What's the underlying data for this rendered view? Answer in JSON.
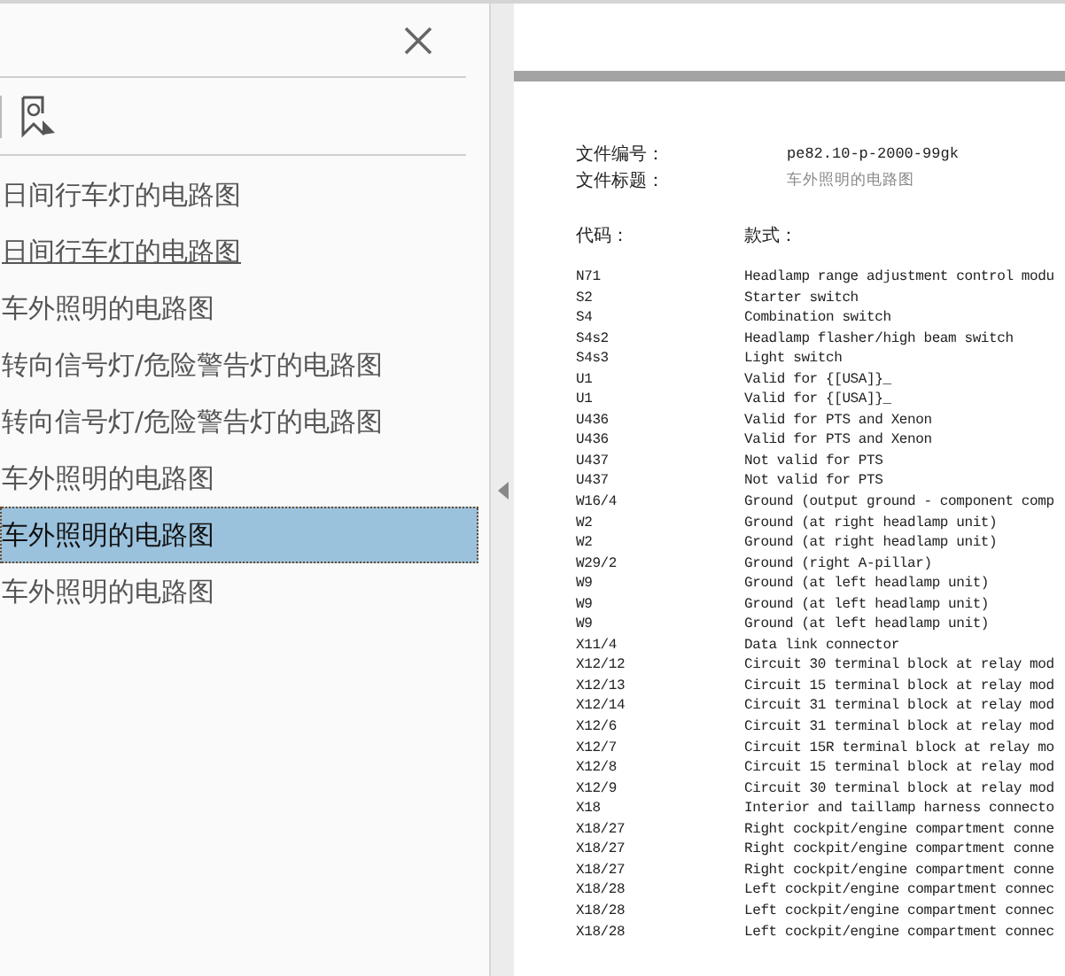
{
  "bookmarks_panel": {
    "items": [
      {
        "label": "日间行车灯的电路图",
        "selected": false,
        "hovered": false
      },
      {
        "label": "日间行车灯的电路图",
        "selected": false,
        "hovered": true
      },
      {
        "label": "车外照明的电路图",
        "selected": false,
        "hovered": false
      },
      {
        "label": "转向信号灯/危险警告灯的电路图",
        "selected": false,
        "hovered": false
      },
      {
        "label": "转向信号灯/危险警告灯的电路图",
        "selected": false,
        "hovered": false
      },
      {
        "label": "车外照明的电路图",
        "selected": false,
        "hovered": false
      },
      {
        "label": "车外照明的电路图",
        "selected": true,
        "hovered": false
      },
      {
        "label": "车外照明的电路图",
        "selected": false,
        "hovered": false
      }
    ]
  },
  "document": {
    "header": [
      {
        "label": "文件编号：",
        "value": "pe82.10-p-2000-99gk"
      },
      {
        "label": "文件标题：",
        "value": "车外照明的电路图"
      }
    ],
    "columns": [
      "代码：",
      "款式："
    ],
    "rows": [
      {
        "code": "N71",
        "description": "Headlamp range adjustment control modu"
      },
      {
        "code": "S2",
        "description": "Starter switch"
      },
      {
        "code": "S4",
        "description": "Combination switch"
      },
      {
        "code": "S4s2",
        "description": "Headlamp flasher/high beam switch"
      },
      {
        "code": "S4s3",
        "description": "Light switch"
      },
      {
        "code": "U1",
        "description": "Valid for {[USA]}_"
      },
      {
        "code": "U1",
        "description": "Valid for {[USA]}_"
      },
      {
        "code": "U436",
        "description": "Valid for PTS and Xenon"
      },
      {
        "code": "U436",
        "description": "Valid for PTS and Xenon"
      },
      {
        "code": "U437",
        "description": "Not valid for PTS"
      },
      {
        "code": "U437",
        "description": "Not valid for PTS"
      },
      {
        "code": "W16/4",
        "description": "Ground (output ground - component comp"
      },
      {
        "code": "W2",
        "description": "Ground (at right headlamp unit)"
      },
      {
        "code": "W2",
        "description": "Ground (at right headlamp unit)"
      },
      {
        "code": "W29/2",
        "description": "Ground (right A-pillar)"
      },
      {
        "code": "W9",
        "description": "Ground (at left headlamp unit)"
      },
      {
        "code": "W9",
        "description": "Ground (at left headlamp unit)"
      },
      {
        "code": "W9",
        "description": "Ground (at left headlamp unit)"
      },
      {
        "code": "X11/4",
        "description": "Data link connector"
      },
      {
        "code": "X12/12",
        "description": "Circuit 30 terminal block at relay mod"
      },
      {
        "code": "X12/13",
        "description": "Circuit 15 terminal block at relay mod"
      },
      {
        "code": "X12/14",
        "description": "Circuit 31 terminal block at relay mod"
      },
      {
        "code": "X12/6",
        "description": "Circuit 31 terminal block at relay mod"
      },
      {
        "code": "X12/7",
        "description": "Circuit 15R terminal block at relay mo"
      },
      {
        "code": "X12/8",
        "description": "Circuit 15 terminal block at relay mod"
      },
      {
        "code": "X12/9",
        "description": "Circuit 30 terminal block at relay mod"
      },
      {
        "code": "X18",
        "description": "Interior and taillamp harness connecto"
      },
      {
        "code": "X18/27",
        "description": "Right cockpit/engine compartment conne"
      },
      {
        "code": "X18/27",
        "description": "Right cockpit/engine compartment conne"
      },
      {
        "code": "X18/27",
        "description": "Right cockpit/engine compartment conne"
      },
      {
        "code": "X18/28",
        "description": "Left cockpit/engine compartment connec"
      },
      {
        "code": "X18/28",
        "description": "Left cockpit/engine compartment connec"
      },
      {
        "code": "X18/28",
        "description": "Left cockpit/engine compartment connec"
      }
    ]
  }
}
